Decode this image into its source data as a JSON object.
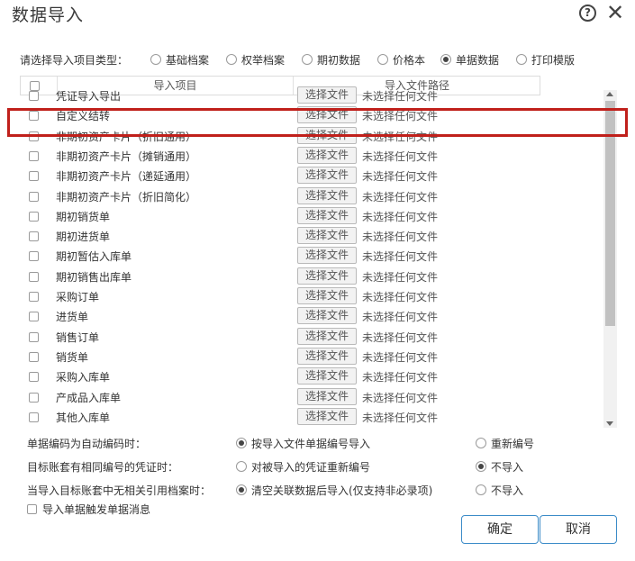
{
  "dialog": {
    "title": "数据导入",
    "help_icon": "question-circle-icon",
    "close_icon": "close-icon",
    "help_glyph": "?",
    "close_glyph": "✕"
  },
  "import_type": {
    "label": "请选择导入项目类型：",
    "options": [
      {
        "label": "基础档案",
        "selected": false
      },
      {
        "label": "权举档案",
        "selected": false
      },
      {
        "label": "期初数据",
        "selected": false
      },
      {
        "label": "价格本",
        "selected": false
      },
      {
        "label": "单据数据",
        "selected": true
      },
      {
        "label": "打印模版",
        "selected": false
      }
    ]
  },
  "table": {
    "headers": {
      "item": "导入项目",
      "path": "导入文件路径"
    },
    "file_button_label": "选择文件",
    "file_status": "未选择任何文件",
    "rows": [
      "凭证导入导出",
      "自定义结转",
      "非期初资产卡片（折旧通用）",
      "非期初资产卡片（摊销通用）",
      "非期初资产卡片（递延通用）",
      "非期初资产卡片（折旧简化）",
      "期初销货单",
      "期初进货单",
      "期初暂估入库单",
      "期初销售出库单",
      "采购订单",
      "进货单",
      "销售订单",
      "销货单",
      "采购入库单",
      "产成品入库单",
      "其他入库单"
    ],
    "highlighted_row": "自定义结转"
  },
  "options": [
    {
      "question": "单据编码为自动编码时：",
      "choices": [
        {
          "label": "按导入文件单据编号导入",
          "selected": true
        },
        {
          "label": "重新编号",
          "selected": false
        }
      ]
    },
    {
      "question": "目标账套有相同编号的凭证时：",
      "choices": [
        {
          "label": "对被导入的凭证重新编号",
          "selected": false
        },
        {
          "label": "不导入",
          "selected": true
        }
      ]
    },
    {
      "question": "当导入目标账套中无相关引用档案时：",
      "choices": [
        {
          "label": "清空关联数据后导入(仅支持非必录项)",
          "selected": true
        },
        {
          "label": "不导入",
          "selected": false
        }
      ]
    }
  ],
  "notify_checkbox": {
    "label": "导入单据触发单据消息",
    "checked": false
  },
  "buttons": {
    "ok": "确定",
    "cancel": "取消"
  },
  "colors": {
    "highlight": "#c0201b",
    "button_border": "#3c8cc8"
  }
}
